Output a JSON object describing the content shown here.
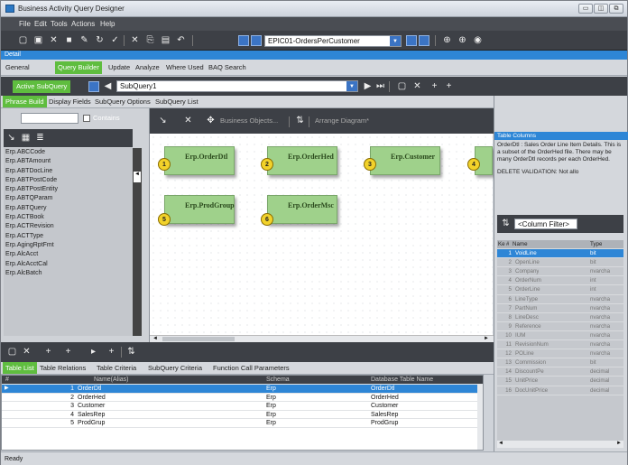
{
  "window": {
    "title": "Business Activity Query Designer"
  },
  "menu": [
    "File",
    "Edit",
    "Tools",
    "Actions",
    "Help"
  ],
  "toolbar": {
    "query_combo": "EPIC01-OrdersPerCustomer"
  },
  "detail_label": "Detail",
  "main_tabs": [
    "General",
    "Query Builder",
    "Update",
    "Analyze",
    "Where Used",
    "BAQ Search"
  ],
  "subquery": {
    "button": "Active SubQuery",
    "combo": "SubQuery1"
  },
  "sub_tabs": [
    "Phrase Build",
    "Display Fields",
    "SubQuery Options",
    "SubQuery List"
  ],
  "left_panel": {
    "contains_label": "Contains",
    "tables": [
      "Erp.ABCCode",
      "Erp.ABTAmount",
      "Erp.ABTDocLine",
      "Erp.ABTPostCode",
      "Erp.ABTPostEntity",
      "Erp.ABTQParam",
      "Erp.ABTQuery",
      "Erp.ACTBook",
      "Erp.ACTRevision",
      "Erp.ACTType",
      "Erp.AgingRptFmt",
      "Erp.AlcAcct",
      "Erp.AlcAcctCal",
      "Erp.AlcBatch"
    ]
  },
  "canvas_toolbar": {
    "business_objects": "Business Objects...",
    "arrange": "Arrange Diagram*"
  },
  "diagram_tables": [
    {
      "num": "1",
      "name": "Erp.OrderDtl"
    },
    {
      "num": "2",
      "name": "Erp.OrderHed"
    },
    {
      "num": "3",
      "name": "Erp.Customer"
    },
    {
      "num": "4",
      "name": ""
    },
    {
      "num": "5",
      "name": "Erp.ProdGroup"
    },
    {
      "num": "6",
      "name": "Erp.OrderMsc"
    }
  ],
  "bottom_tabs": [
    "Table List",
    "Table Relations",
    "Table Criteria",
    "SubQuery Criteria",
    "Function Call Parameters"
  ],
  "grid": {
    "headers": [
      "#",
      "Name(Alias)",
      "Schema",
      "Database Table Name"
    ],
    "rows": [
      {
        "n": "1",
        "name": "OrderDtl",
        "schema": "Erp",
        "db": "OrderDtl"
      },
      {
        "n": "2",
        "name": "OrderHed",
        "schema": "Erp",
        "db": "OrderHed"
      },
      {
        "n": "3",
        "name": "Customer",
        "schema": "Erp",
        "db": "Customer"
      },
      {
        "n": "4",
        "name": "SalesRep",
        "schema": "Erp",
        "db": "SalesRep"
      },
      {
        "n": "5",
        "name": "ProdGrup",
        "schema": "Erp",
        "db": "ProdGrup"
      }
    ]
  },
  "right_panel": {
    "header": "Table Columns",
    "description": "OrderDtl : Sales Order Line Item Details. This is a subset of the OrderHed file. There may be many OrderDtl records per each OrderHed.",
    "validation": "DELETE VALIDATION:  Not allo",
    "filter": "<Column Filter>",
    "col_headers": [
      "Ke",
      "#",
      "Name",
      "Type"
    ],
    "columns": [
      {
        "n": "1",
        "name": "VoidLine",
        "type": "bit"
      },
      {
        "n": "2",
        "name": "OpenLine",
        "type": "bit"
      },
      {
        "n": "3",
        "name": "Company",
        "type": "nvarcha"
      },
      {
        "n": "4",
        "name": "OrderNum",
        "type": "int"
      },
      {
        "n": "5",
        "name": "OrderLine",
        "type": "int"
      },
      {
        "n": "6",
        "name": "LineType",
        "type": "nvarcha"
      },
      {
        "n": "7",
        "name": "PartNum",
        "type": "nvarcha"
      },
      {
        "n": "8",
        "name": "LineDesc",
        "type": "nvarcha"
      },
      {
        "n": "9",
        "name": "Reference",
        "type": "nvarcha"
      },
      {
        "n": "10",
        "name": "IUM",
        "type": "nvarcha"
      },
      {
        "n": "11",
        "name": "RevisionNum",
        "type": "nvarcha"
      },
      {
        "n": "12",
        "name": "POLine",
        "type": "nvarcha"
      },
      {
        "n": "13",
        "name": "Commission",
        "type": "bit"
      },
      {
        "n": "14",
        "name": "DiscountPe",
        "type": "decimal"
      },
      {
        "n": "15",
        "name": "UnitPrice",
        "type": "decimal"
      },
      {
        "n": "16",
        "name": "DocUnitPrice",
        "type": "decimal"
      }
    ]
  },
  "status": "Ready"
}
